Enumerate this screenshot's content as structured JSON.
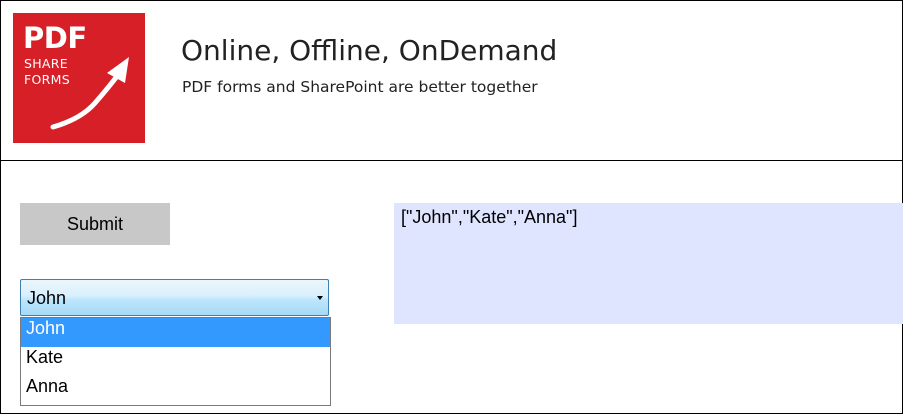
{
  "logo": {
    "line1": "PDF",
    "line2": "SHARE",
    "line3": "FORMS",
    "color": "#d71f27"
  },
  "header": {
    "title": "Online, Offline, OnDemand",
    "subtitle": "PDF forms and SharePoint are better together"
  },
  "form": {
    "submit_label": "Submit",
    "select_value": "John",
    "options": [
      "John",
      "Kate",
      "Anna"
    ],
    "selected_index": 0,
    "output_text": "[\"John\",\"Kate\",\"Anna\"]"
  },
  "colors": {
    "highlight": "#3399ff",
    "output_bg": "#dfe4ff"
  }
}
